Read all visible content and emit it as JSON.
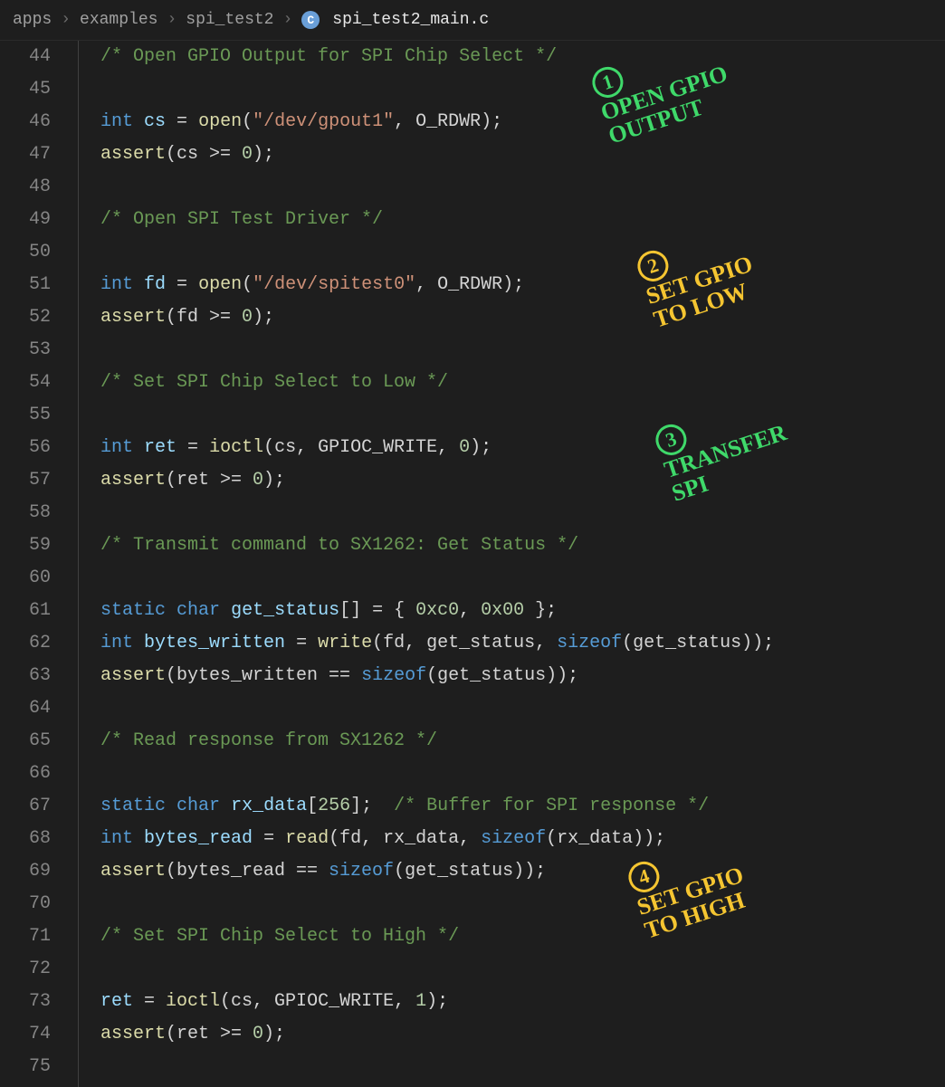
{
  "breadcrumbs": {
    "seg1": "apps",
    "seg2": "examples",
    "seg3": "spi_test2",
    "icon_letter": "C",
    "filename": "spi_test2_main.c"
  },
  "lines": {
    "start": 44,
    "end": 75
  },
  "code": {
    "l44_comment": "/* Open GPIO Output for SPI Chip Select */",
    "l46_kw": "int",
    "l46_var": "cs",
    "l46_eq": " = ",
    "l46_fn": "open",
    "l46_p1": "(",
    "l46_str": "\"/dev/gpout1\"",
    "l46_c": ", ",
    "l46_macro": "O_RDWR",
    "l46_p2": ");",
    "l47_fn": "assert",
    "l47_body": "(cs >= ",
    "l47_num": "0",
    "l47_end": ");",
    "l49_comment": "/* Open SPI Test Driver */",
    "l51_kw": "int",
    "l51_var": "fd",
    "l51_eq": " = ",
    "l51_fn": "open",
    "l51_p1": "(",
    "l51_str": "\"/dev/spitest0\"",
    "l51_c": ", ",
    "l51_macro": "O_RDWR",
    "l51_p2": ");",
    "l52_fn": "assert",
    "l52_body": "(fd >= ",
    "l52_num": "0",
    "l52_end": ");",
    "l54_comment": "/* Set SPI Chip Select to Low */",
    "l56_kw": "int",
    "l56_var": "ret",
    "l56_eq": " = ",
    "l56_fn": "ioctl",
    "l56_args": "(cs, GPIOC_WRITE, ",
    "l56_num": "0",
    "l56_end": ");",
    "l57_fn": "assert",
    "l57_body": "(ret >= ",
    "l57_num": "0",
    "l57_end": ");",
    "l59_comment": "/* Transmit command to SX1262: Get Status */",
    "l61_kw1": "static",
    "l61_kw2": "char",
    "l61_var": "get_status",
    "l61_br": "[]",
    "l61_eq": " = { ",
    "l61_n1": "0xc0",
    "l61_c": ", ",
    "l61_n2": "0x00",
    "l61_end": " };",
    "l62_kw": "int",
    "l62_var": "bytes_written",
    "l62_eq": " = ",
    "l62_fn": "write",
    "l62_p1": "(fd, get_status, ",
    "l62_sz": "sizeof",
    "l62_p2": "(get_status));",
    "l63_fn": "assert",
    "l63_p1": "(bytes_written == ",
    "l63_sz": "sizeof",
    "l63_p2": "(get_status));",
    "l65_comment": "/* Read response from SX1262 */",
    "l67_kw1": "static",
    "l67_kw2": "char",
    "l67_var": "rx_data",
    "l67_br1": "[",
    "l67_num": "256",
    "l67_br2": "];  ",
    "l67_comment": "/* Buffer for SPI response */",
    "l68_kw": "int",
    "l68_var": "bytes_read",
    "l68_eq": " = ",
    "l68_fn": "read",
    "l68_p1": "(fd, rx_data, ",
    "l68_sz": "sizeof",
    "l68_p2": "(rx_data));",
    "l69_fn": "assert",
    "l69_p1": "(bytes_read == ",
    "l69_sz": "sizeof",
    "l69_p2": "(get_status));",
    "l71_comment": "/* Set SPI Chip Select to High */",
    "l73_var": "ret",
    "l73_eq": " = ",
    "l73_fn": "ioctl",
    "l73_args": "(cs, GPIOC_WRITE, ",
    "l73_num": "1",
    "l73_end": ");",
    "l74_fn": "assert",
    "l74_body": "(ret >= ",
    "l74_num": "0",
    "l74_end": ");"
  },
  "annotations": {
    "a1_num": "1",
    "a1_line1": "OPEN GPIO",
    "a1_line2": "OUTPUT",
    "a2_num": "2",
    "a2_line1": "SET GPIO",
    "a2_line2": "TO LOW",
    "a3_num": "3",
    "a3_line1": "TRANSFER",
    "a3_line2": "SPI",
    "a4_num": "4",
    "a4_line1": "SET GPIO",
    "a4_line2": "TO HIGH"
  }
}
